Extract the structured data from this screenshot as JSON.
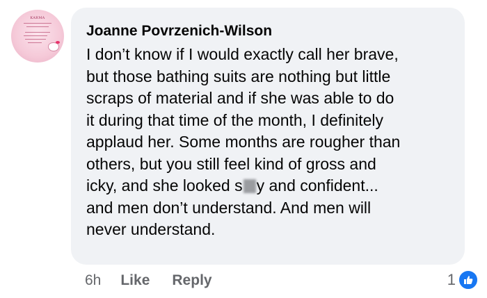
{
  "comment": {
    "author": "Joanne Povrzenich-Wilson",
    "lines": [
      "I don’t know if I would exactly call her brave,",
      "but those bathing suits are nothing but little",
      "scraps of material and if she was able to do",
      "it during that time of the month, I definitely",
      "applaud her. Some months are rougher than",
      "others, but you still feel kind of gross and"
    ],
    "line7_before": "icky, and she looked s",
    "line7_after": "y and confident...",
    "lines_end": [
      "and men don’t understand. And men will",
      "never understand."
    ]
  },
  "avatar": {
    "title": "KARMA"
  },
  "actions": {
    "time": "6h",
    "like": "Like",
    "reply": "Reply"
  },
  "reactions": {
    "count": "1",
    "icon": "thumbs-up-icon",
    "color": "#1877f2"
  },
  "colors": {
    "bubble": "#f0f2f5",
    "text": "#050505",
    "meta": "#65676b"
  }
}
